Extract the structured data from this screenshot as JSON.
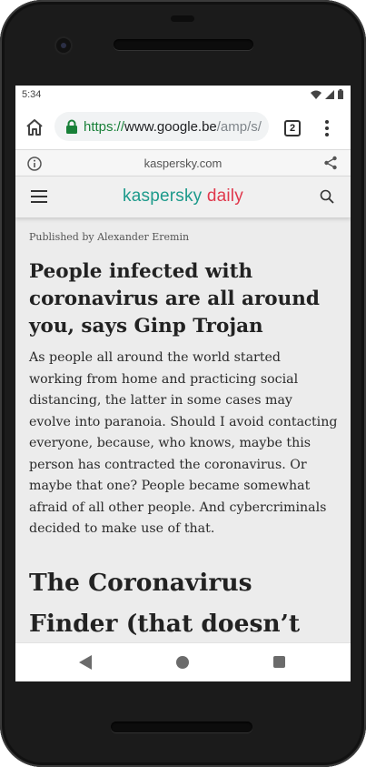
{
  "status_bar": {
    "time": "5:34"
  },
  "browser": {
    "url_protocol": "https://",
    "url_host": "www.google.be",
    "url_path": "/amp/s/",
    "tab_count": "2",
    "amp_domain": "kaspersky.com",
    "accent_color": "#188038"
  },
  "site": {
    "logo_part1": "kaspersky",
    "logo_part2": " daily",
    "logo_colors": {
      "kaspersky": "#1d9a8b",
      "daily": "#e0384c"
    }
  },
  "article": {
    "byline": "Published by Alexander Eremin",
    "headline": "People infected with coronavirus are all around you, says Ginp Trojan",
    "body": "As people all around the world started working from home and practicing social distancing, the latter in some cases may evolve into paranoia. Should I avoid contacting everyone, because, who knows, maybe this person has contracted the coronavirus. Or maybe that one? People became somewhat afraid of all other people. And cybercriminals decided to make use of that.",
    "subheading": "The Coronavirus Finder (that doesn’t work)"
  },
  "icons": {
    "home": "home-icon",
    "lock": "lock-icon",
    "menu": "more-vert-icon",
    "info": "info-icon",
    "share": "share-icon",
    "hamburger": "hamburger-icon",
    "search": "search-icon",
    "back": "back-icon",
    "nav_home": "circle-home-icon",
    "recents": "recents-icon",
    "wifi": "wifi-icon",
    "signal": "signal-icon",
    "battery": "battery-icon"
  }
}
